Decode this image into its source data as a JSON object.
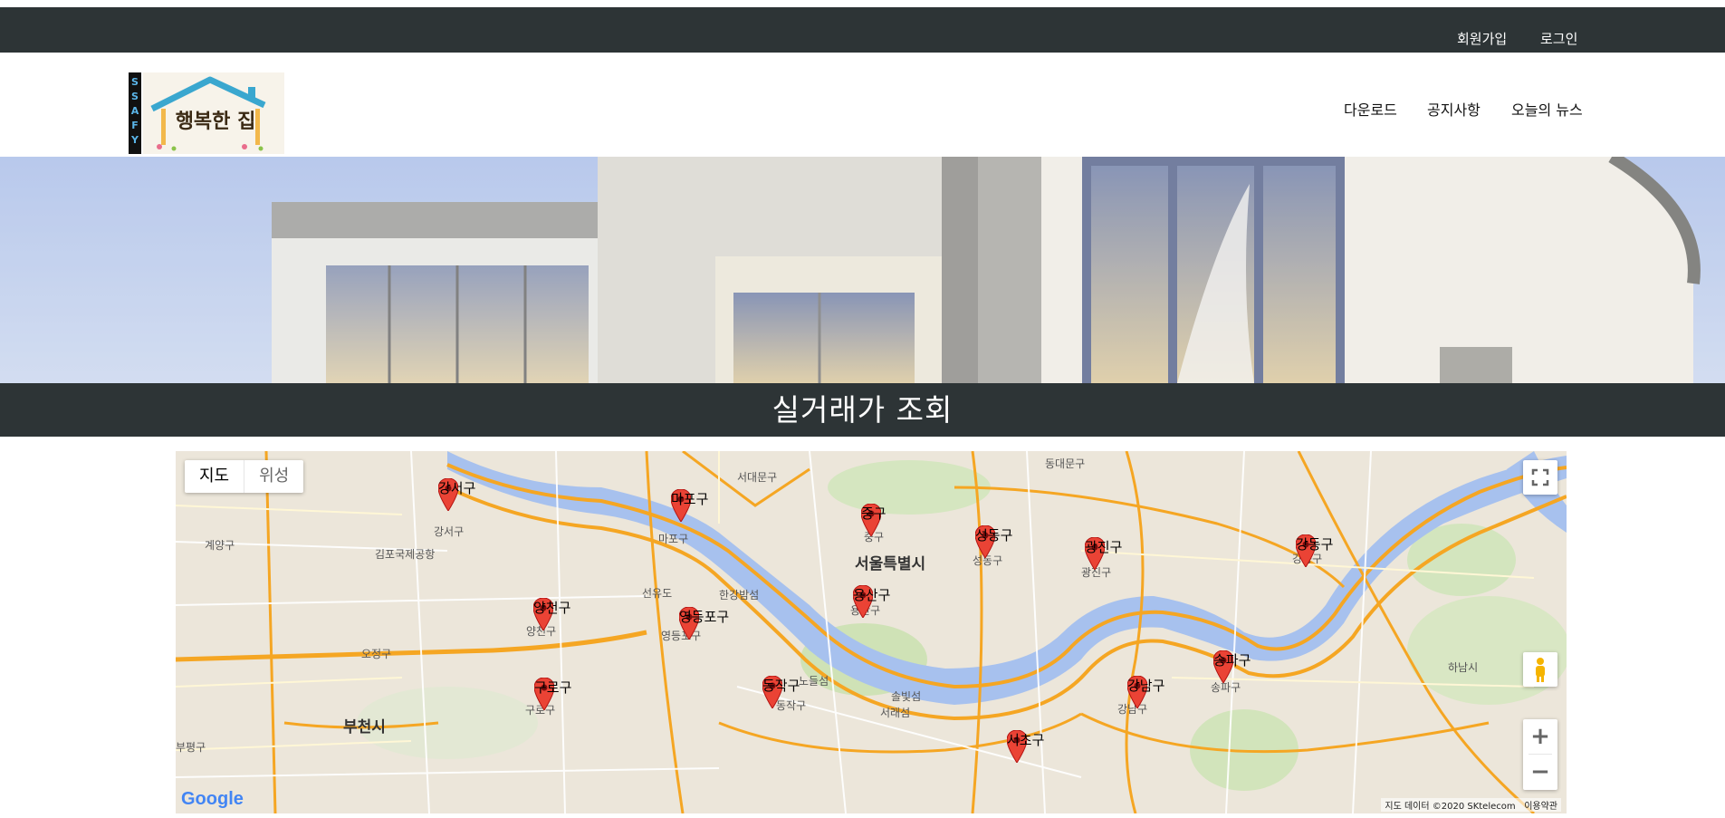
{
  "topbar": {
    "signup": "회원가입",
    "login": "로그인"
  },
  "logo": {
    "side_text": "SSAFY",
    "title": "행복한 집"
  },
  "nav": {
    "download": "다운로드",
    "notice": "공지사항",
    "news": "오늘의 뉴스"
  },
  "page": {
    "title": "실거래가 조회"
  },
  "map": {
    "type_map": "지도",
    "type_satellite": "위성",
    "city_seoul": "서울특별시",
    "city_bucheon": "부천시",
    "attribution": "지도 데이터 ©2020 SKtelecom",
    "terms": "이용약관",
    "google": "Google",
    "zoom_in": "+",
    "zoom_out": "−",
    "markers": [
      {
        "name": "강서구"
      },
      {
        "name": "마포구"
      },
      {
        "name": "중구"
      },
      {
        "name": "성동구"
      },
      {
        "name": "광진구"
      },
      {
        "name": "강동구"
      },
      {
        "name": "양천구"
      },
      {
        "name": "용산구"
      },
      {
        "name": "영등포구"
      },
      {
        "name": "구로구"
      },
      {
        "name": "동작구"
      },
      {
        "name": "강남구"
      },
      {
        "name": "송파구"
      },
      {
        "name": "서초구"
      }
    ],
    "district_labels": [
      "서대문구",
      "동대문구",
      "강서구",
      "마포구",
      "중구",
      "성동구",
      "광진구",
      "강동구",
      "양천구",
      "용산구",
      "영등포구",
      "구로구",
      "동작구",
      "강남구",
      "송파구",
      "계양구",
      "김포국제공항",
      "오정구",
      "선유도",
      "한강밤섬",
      "노들섬",
      "솔빛섬",
      "서래섬",
      "하남시",
      "부평구"
    ]
  }
}
